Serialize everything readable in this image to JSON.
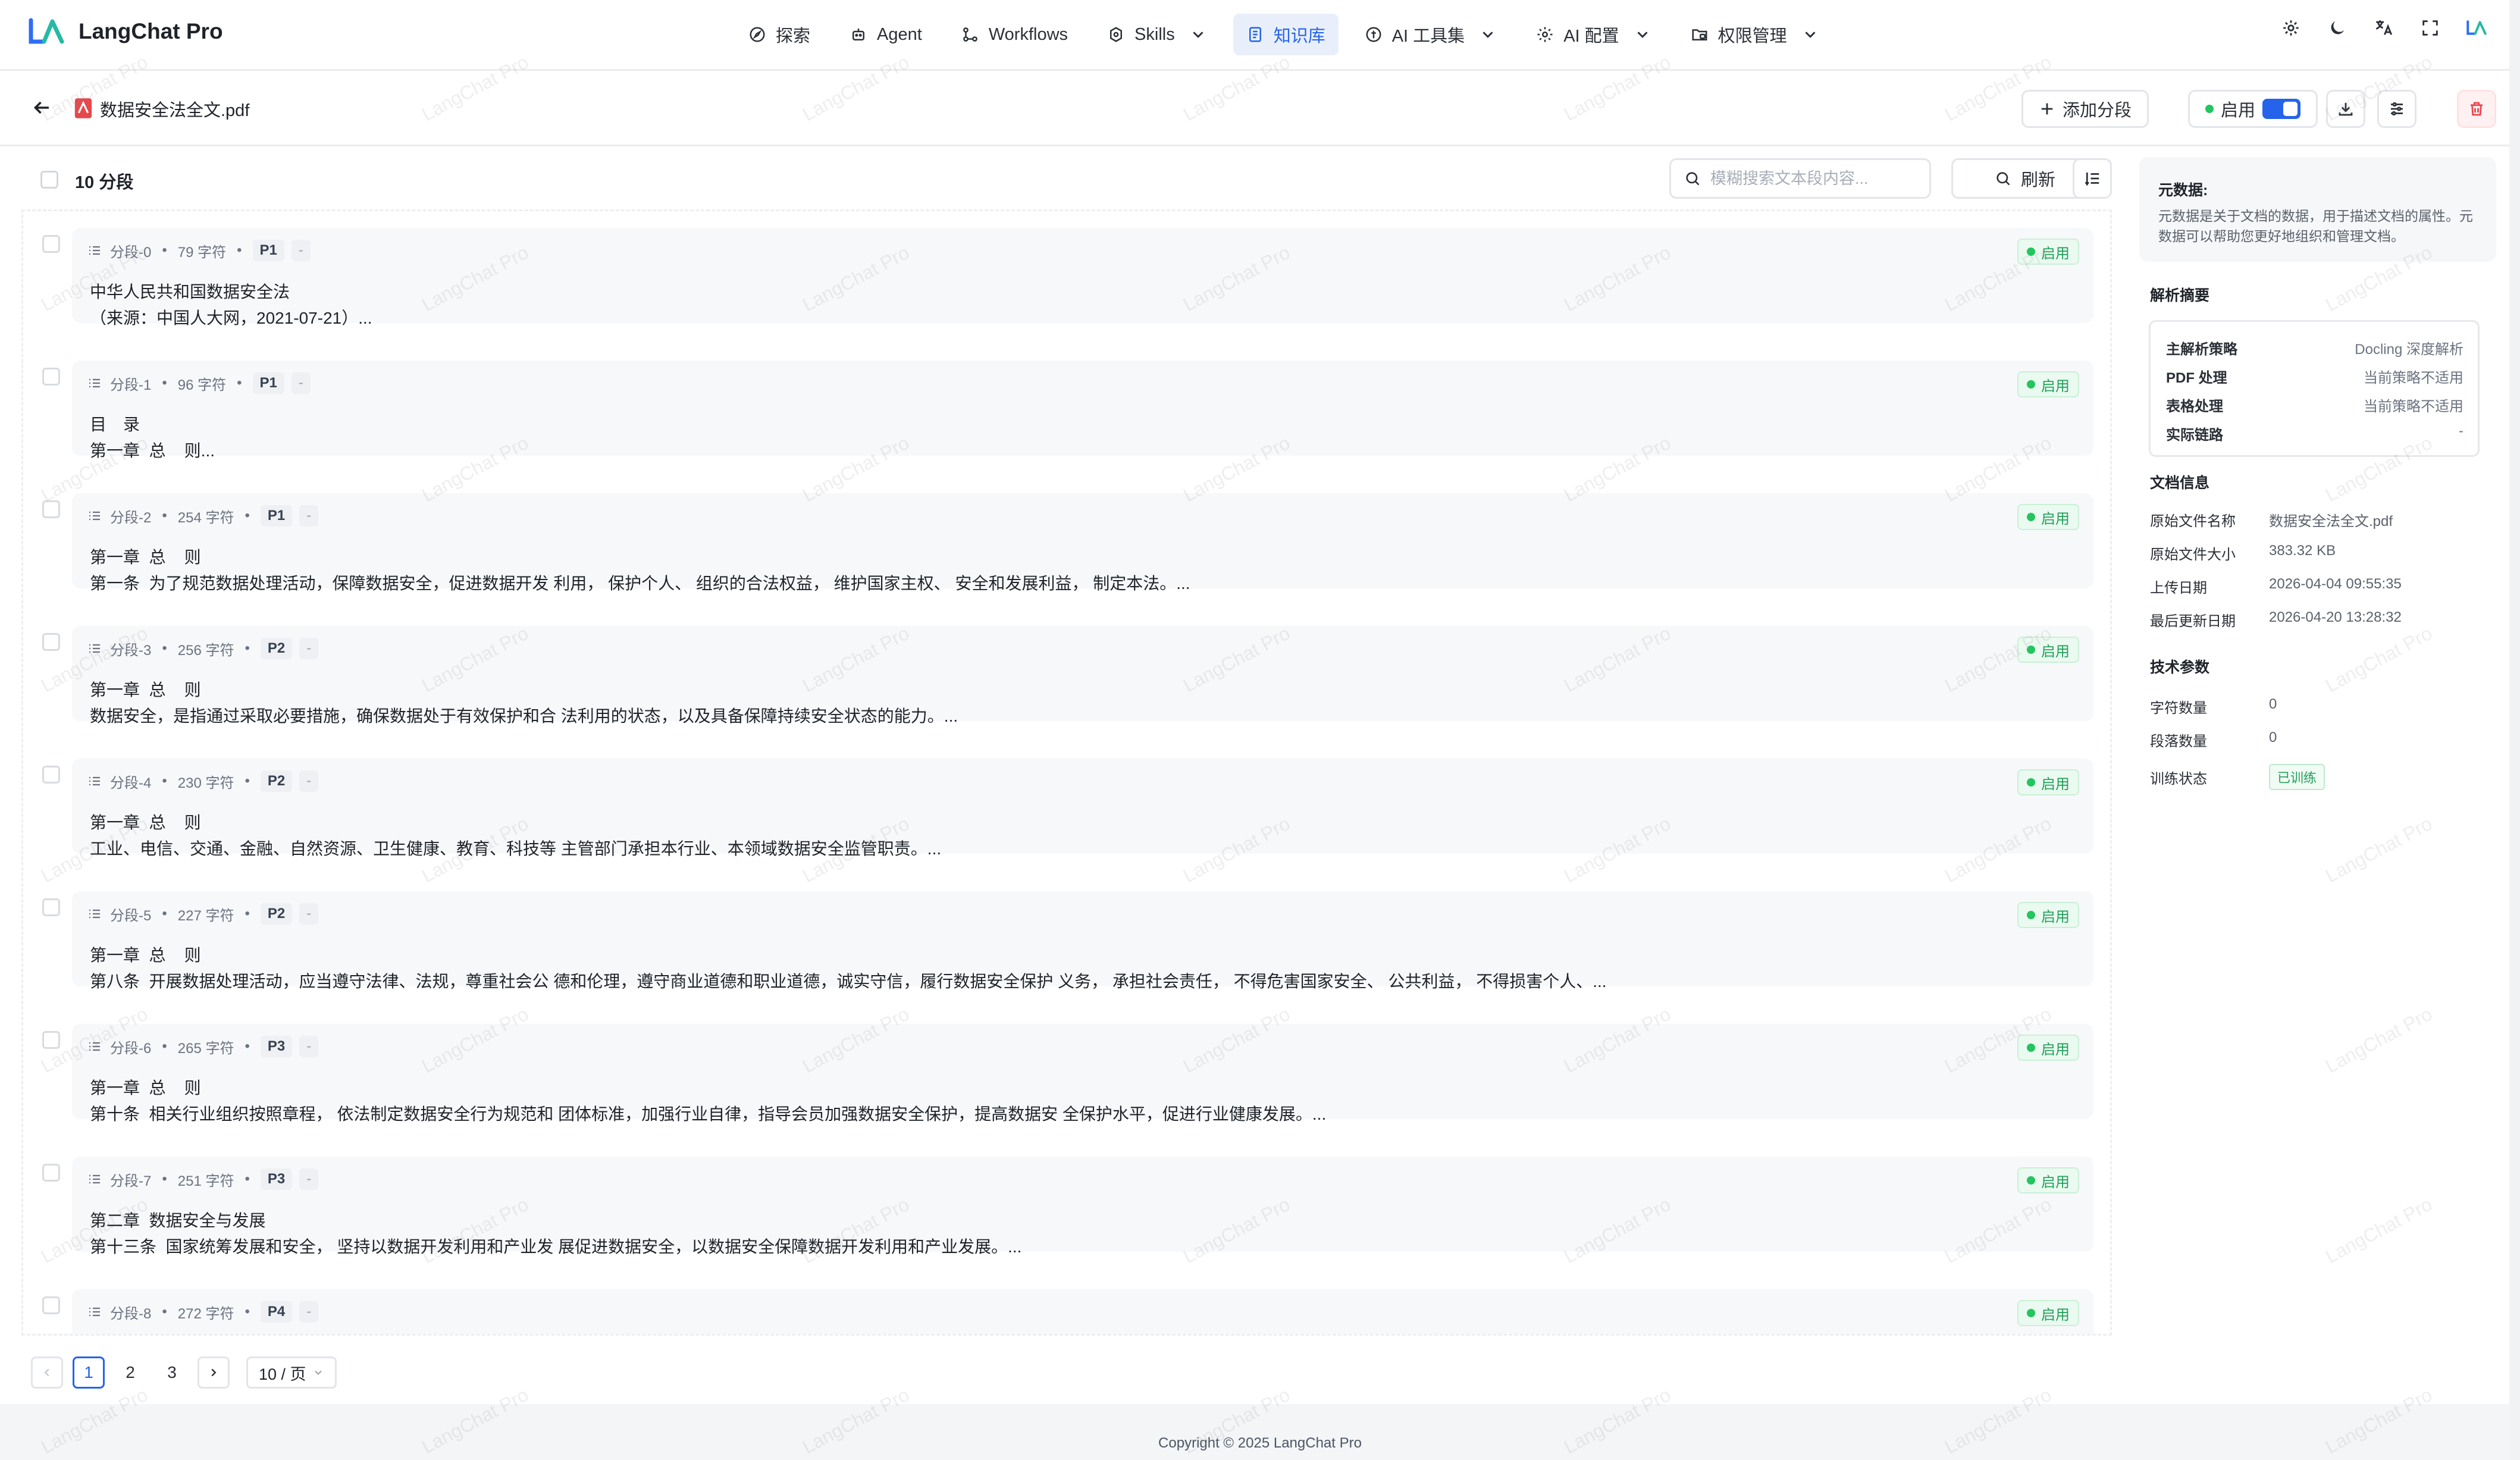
{
  "app": {
    "name": "LangChat Pro",
    "accent": "#2563eb"
  },
  "nav": [
    {
      "label": "探索",
      "icon": "compass-icon",
      "dropdown": false,
      "active": false
    },
    {
      "label": "Agent",
      "icon": "robot-icon",
      "dropdown": false,
      "active": false
    },
    {
      "label": "Workflows",
      "icon": "workflow-icon",
      "dropdown": false,
      "active": false
    },
    {
      "label": "Skills",
      "icon": "skills-icon",
      "dropdown": true,
      "active": false
    },
    {
      "label": "知识库",
      "icon": "book-icon",
      "dropdown": false,
      "active": true
    },
    {
      "label": "AI 工具集",
      "icon": "tools-icon",
      "dropdown": true,
      "active": false
    },
    {
      "label": "AI 配置",
      "icon": "gear-icon",
      "dropdown": true,
      "active": false
    },
    {
      "label": "权限管理",
      "icon": "folder-lock-icon",
      "dropdown": true,
      "active": false
    }
  ],
  "doc": {
    "title": "数据安全法全文.pdf",
    "add_segment_label": "添加分段",
    "enable_label": "启用"
  },
  "toolbar": {
    "segment_count_label": "10 分段",
    "search_placeholder": "模糊搜索文本段内容...",
    "refresh_label": "刷新"
  },
  "segments": [
    {
      "name": "分段-0",
      "chars": "79 字符",
      "page": "P1",
      "dash": "-",
      "status": "启用",
      "line1": "中华人民共和国数据安全法",
      "line2": "（来源：中国人大网，2021-07-21）..."
    },
    {
      "name": "分段-1",
      "chars": "96 字符",
      "page": "P1",
      "dash": "-",
      "status": "启用",
      "line1": "目　录",
      "line2": "第一章  总    则..."
    },
    {
      "name": "分段-2",
      "chars": "254 字符",
      "page": "P1",
      "dash": "-",
      "status": "启用",
      "line1": "第一章  总    则",
      "line2": "第一条  为了规范数据处理活动，保障数据安全，促进数据开发 利用， 保护个人、 组织的合法权益， 维护国家主权、 安全和发展利益， 制定本法。..."
    },
    {
      "name": "分段-3",
      "chars": "256 字符",
      "page": "P2",
      "dash": "-",
      "status": "启用",
      "line1": "第一章  总    则",
      "line2": "数据安全，是指通过采取必要措施，确保数据处于有效保护和合 法利用的状态，以及具备保障持续安全状态的能力。..."
    },
    {
      "name": "分段-4",
      "chars": "230 字符",
      "page": "P2",
      "dash": "-",
      "status": "启用",
      "line1": "第一章  总    则",
      "line2": "工业、电信、交通、金融、自然资源、卫生健康、教育、科技等 主管部门承担本行业、本领域数据安全监管职责。..."
    },
    {
      "name": "分段-5",
      "chars": "227 字符",
      "page": "P2",
      "dash": "-",
      "status": "启用",
      "line1": "第一章  总    则",
      "line2": "第八条  开展数据处理活动，应当遵守法律、法规，尊重社会公 德和伦理，遵守商业道德和职业道德，诚实守信，履行数据安全保护 义务， 承担社会责任， 不得危害国家安全、 公共利益， 不得损害个人、..."
    },
    {
      "name": "分段-6",
      "chars": "265 字符",
      "page": "P3",
      "dash": "-",
      "status": "启用",
      "line1": "第一章  总    则",
      "line2": "第十条  相关行业组织按照章程， 依法制定数据安全行为规范和 团体标准，加强行业自律，指导会员加强数据安全保护，提高数据安 全保护水平，促进行业健康发展。..."
    },
    {
      "name": "分段-7",
      "chars": "251 字符",
      "page": "P3",
      "dash": "-",
      "status": "启用",
      "line1": "第二章  数据安全与发展",
      "line2": "第十三条  国家统筹发展和安全， 坚持以数据开发利用和产业发 展促进数据安全，以数据安全保障数据开发利用和产业发展。..."
    },
    {
      "name": "分段-8",
      "chars": "272 字符",
      "page": "P4",
      "dash": "-",
      "status": "启用",
      "line1": "",
      "line2": ""
    }
  ],
  "pagination": {
    "pages": [
      "1",
      "2",
      "3"
    ],
    "current": "1",
    "page_size": "10 / 页"
  },
  "sidebar": {
    "metadata_title": "元数据:",
    "metadata_desc": "元数据是关于文档的数据，用于描述文档的属性。元数据可以帮助您更好地组织和管理文档。",
    "parse_title": "解析摘要",
    "parse_rows": [
      {
        "k": "主解析策略",
        "v": "Docling 深度解析"
      },
      {
        "k": "PDF 处理",
        "v": "当前策略不适用"
      },
      {
        "k": "表格处理",
        "v": "当前策略不适用"
      },
      {
        "k": "实际链路",
        "v": "-"
      }
    ],
    "docinfo_title": "文档信息",
    "docinfo_rows": [
      {
        "k": "原始文件名称",
        "v": "数据安全法全文.pdf"
      },
      {
        "k": "原始文件大小",
        "v": "383.32 KB"
      },
      {
        "k": "上传日期",
        "v": "2026-04-04 09:55:35"
      },
      {
        "k": "最后更新日期",
        "v": "2026-04-20 13:28:32"
      }
    ],
    "tech_title": "技术参数",
    "tech_rows": [
      {
        "k": "字符数量",
        "v": "0"
      },
      {
        "k": "段落数量",
        "v": "0"
      },
      {
        "k": "训练状态",
        "v": "已训练"
      }
    ]
  },
  "footer": {
    "copyright": "Copyright © 2025 LangChat Pro"
  },
  "watermark": "LangChat Pro"
}
